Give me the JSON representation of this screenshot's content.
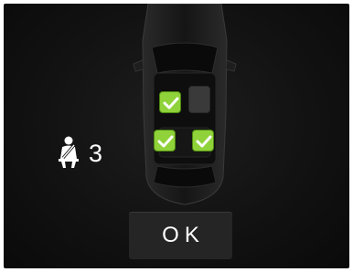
{
  "seatbelt_status": {
    "icon": "seatbelt-icon",
    "buckled_count": "3"
  },
  "seats": {
    "front_left": {
      "state": "buckled",
      "icon": "checkmark-icon"
    },
    "front_right": {
      "state": "unoccupied"
    },
    "rear_left": {
      "state": "buckled",
      "icon": "checkmark-icon"
    },
    "rear_right": {
      "state": "buckled",
      "icon": "checkmark-icon"
    }
  },
  "colors": {
    "buckled_seat": "#8fd23a",
    "background": "#121212",
    "button": "#252525",
    "text": "#ffffff"
  },
  "ok_button": {
    "label": "OK"
  }
}
